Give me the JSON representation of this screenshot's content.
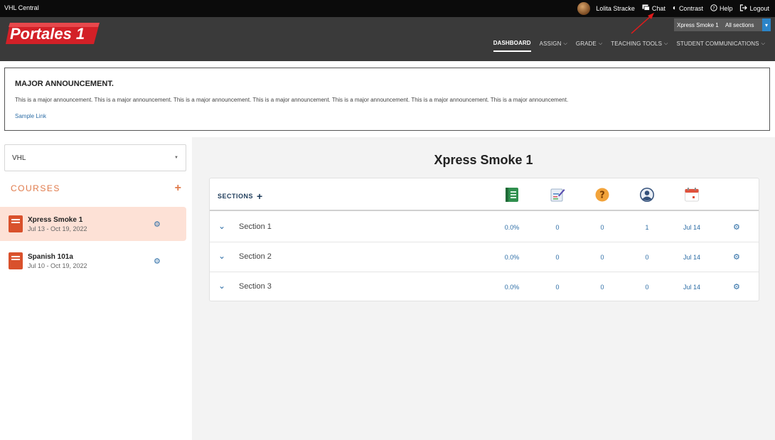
{
  "topbar": {
    "brand": "VHL Central",
    "user": "Lolita Stracke",
    "chat": "Chat",
    "contrast": "Contrast",
    "help": "Help",
    "logout": "Logout"
  },
  "header": {
    "logo_text": "Portales 1",
    "course_picker": {
      "course": "Xpress Smoke 1",
      "sections": "All sections"
    },
    "nav": [
      {
        "label": "DASHBOARD"
      },
      {
        "label": "ASSIGN"
      },
      {
        "label": "GRADE"
      },
      {
        "label": "TEACHING TOOLS"
      },
      {
        "label": "STUDENT COMMUNICATIONS"
      }
    ]
  },
  "announcement": {
    "title": "MAJOR ANNOUNCEMENT.",
    "body": "This is a major announcement. This is a major announcement. This is a major announcement. This is a major announcement. This is a major announcement. This is a major announcement. This is a major announcement.",
    "link": "Sample Link"
  },
  "sidebar": {
    "select_value": "VHL",
    "courses_label": "COURSES",
    "courses": [
      {
        "name": "Xpress Smoke 1",
        "dates": "Jul 13 - Oct 19, 2022"
      },
      {
        "name": "Spanish 101a",
        "dates": "Jul 10 - Oct 19, 2022"
      }
    ]
  },
  "main": {
    "title": "Xpress Smoke 1",
    "sections_label": "SECTIONS",
    "rows": [
      {
        "name": "Section 1",
        "grade": "0.0%",
        "c1": "0",
        "c2": "0",
        "c3": "1",
        "date": "Jul 14"
      },
      {
        "name": "Section 2",
        "grade": "0.0%",
        "c1": "0",
        "c2": "0",
        "c3": "0",
        "date": "Jul 14"
      },
      {
        "name": "Section 3",
        "grade": "0.0%",
        "c1": "0",
        "c2": "0",
        "c3": "0",
        "date": "Jul 14"
      }
    ]
  },
  "colors": {
    "accent_blue": "#2e6ea6",
    "courses_orange": "#e07a4a",
    "logo_red": "#d32027"
  }
}
